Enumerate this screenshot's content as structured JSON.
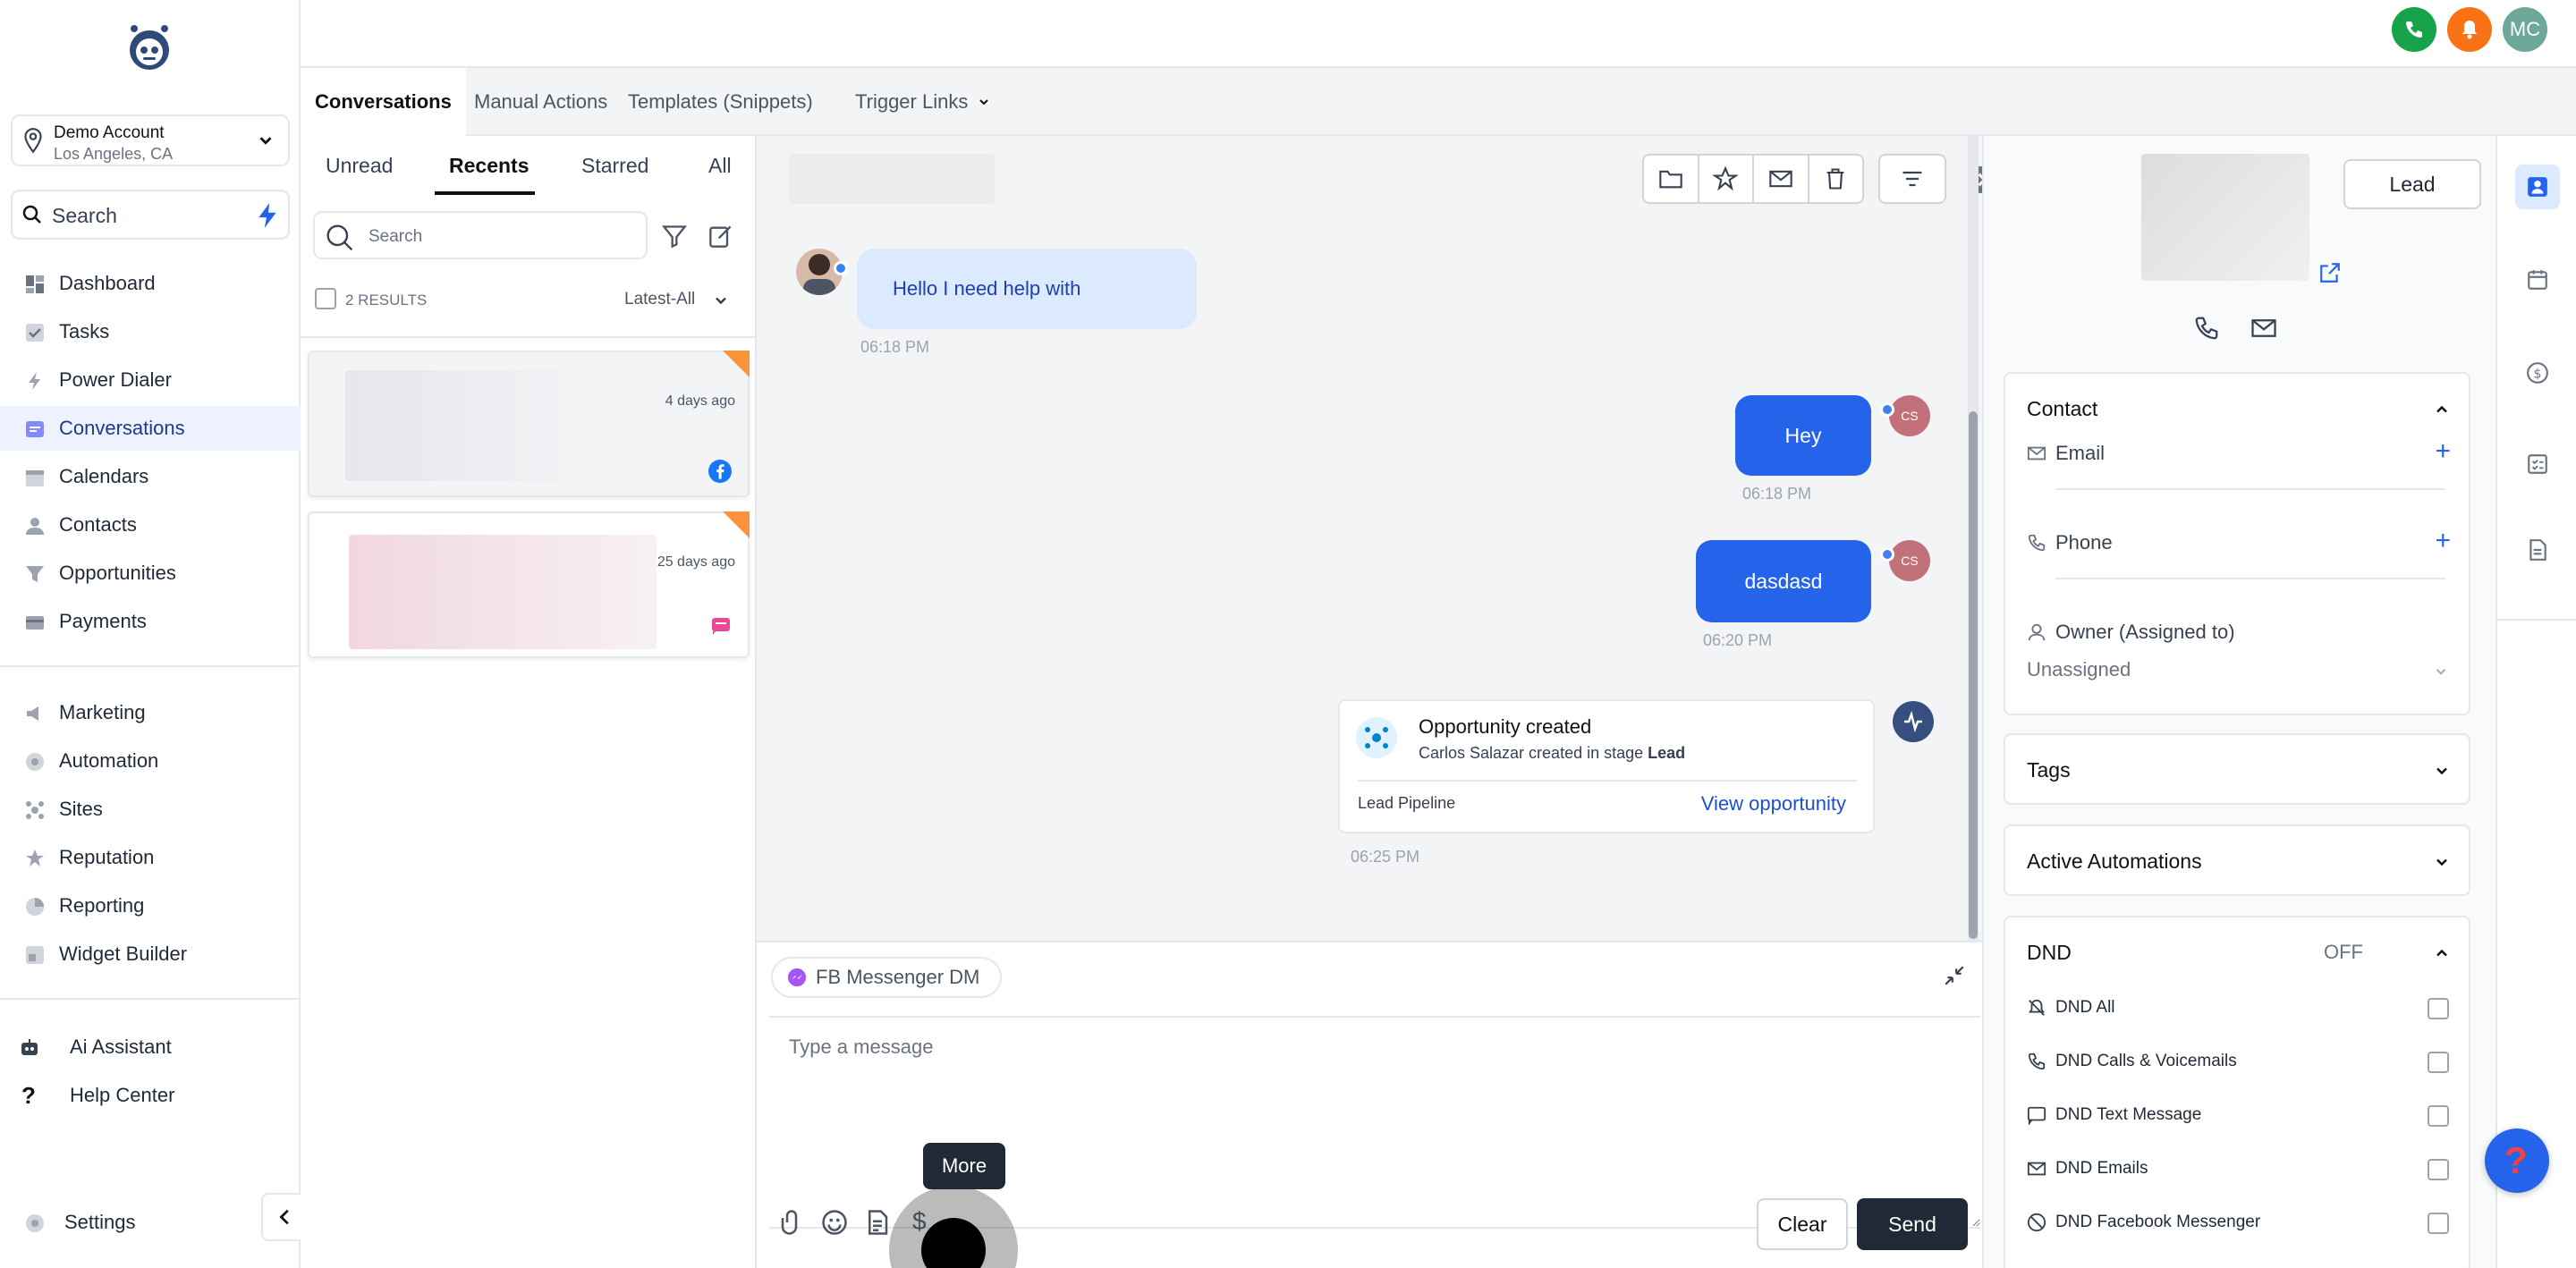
{
  "sidebar": {
    "account_name": "Demo Account",
    "account_location": "Los Angeles, CA",
    "search_label": "Search",
    "nav": [
      {
        "label": "Dashboard",
        "icon": "dashboard-icon"
      },
      {
        "label": "Tasks",
        "icon": "tasks-icon"
      },
      {
        "label": "Power Dialer",
        "icon": "power-dialer-icon"
      },
      {
        "label": "Conversations",
        "icon": "conversations-icon",
        "active": true
      },
      {
        "label": "Calendars",
        "icon": "calendar-icon"
      },
      {
        "label": "Contacts",
        "icon": "contacts-icon"
      },
      {
        "label": "Opportunities",
        "icon": "opportunities-icon"
      },
      {
        "label": "Payments",
        "icon": "payments-icon"
      }
    ],
    "nav2": [
      {
        "label": "Marketing",
        "icon": "marketing-icon"
      },
      {
        "label": "Automation",
        "icon": "automation-icon"
      },
      {
        "label": "Sites",
        "icon": "sites-icon"
      },
      {
        "label": "Reputation",
        "icon": "reputation-icon"
      },
      {
        "label": "Reporting",
        "icon": "reporting-icon"
      },
      {
        "label": "Widget Builder",
        "icon": "widget-builder-icon"
      }
    ],
    "nav3": [
      {
        "label": "Ai Assistant",
        "icon": "ai-assistant-icon"
      },
      {
        "label": "Help Center",
        "icon": "help-icon"
      }
    ],
    "settings_label": "Settings"
  },
  "topbar": {
    "user_initials": "MC",
    "colors": {
      "phone": "#16a34a",
      "bell": "#f97316",
      "avatar": "#6ea89a"
    }
  },
  "tabs": [
    {
      "label": "Conversations",
      "active": true
    },
    {
      "label": "Manual Actions"
    },
    {
      "label": "Templates (Snippets)"
    },
    {
      "label": "Trigger Links"
    }
  ],
  "list": {
    "filters": [
      "Unread",
      "Recents",
      "Starred",
      "All"
    ],
    "active_filter": "Recents",
    "search_placeholder": "Search",
    "results_label": "2 RESULTS",
    "sort_label": "Latest-All",
    "items": [
      {
        "time": "4 days ago",
        "channel_icon": "facebook-icon"
      },
      {
        "time": "25 days ago",
        "channel_icon": "sms-icon"
      }
    ]
  },
  "chat": {
    "messages": [
      {
        "direction": "in",
        "text": "Hello I need help with",
        "time": "06:18 PM"
      },
      {
        "direction": "out",
        "text": "Hey",
        "time": "06:18 PM",
        "avatar": "CS"
      },
      {
        "direction": "out",
        "text": "dasdasd",
        "time": "06:20 PM",
        "avatar": "CS"
      }
    ],
    "opportunity": {
      "title": "Opportunity created",
      "subtitle_prefix": "Carlos Salazar created in stage",
      "stage": "Lead",
      "pipeline": "Lead Pipeline",
      "link": "View opportunity",
      "time": "06:25 PM"
    }
  },
  "composer": {
    "channel": "FB Messenger DM",
    "placeholder": "Type a message",
    "tooltip": "More",
    "clear_label": "Clear",
    "send_label": "Send"
  },
  "contact": {
    "lead_label": "Lead",
    "section_contact": "Contact",
    "email_label": "Email",
    "phone_label": "Phone",
    "owner_label": "Owner (Assigned to)",
    "owner_value": "Unassigned",
    "tags": "Tags",
    "automations": "Active Automations",
    "dnd": "DND",
    "dnd_state": "OFF",
    "dnd_items": [
      "DND All",
      "DND Calls & Voicemails",
      "DND Text Message",
      "DND Emails",
      "DND Facebook Messenger"
    ]
  },
  "colors": {
    "accent": "#2563eb",
    "send_button": "#1f2937"
  }
}
